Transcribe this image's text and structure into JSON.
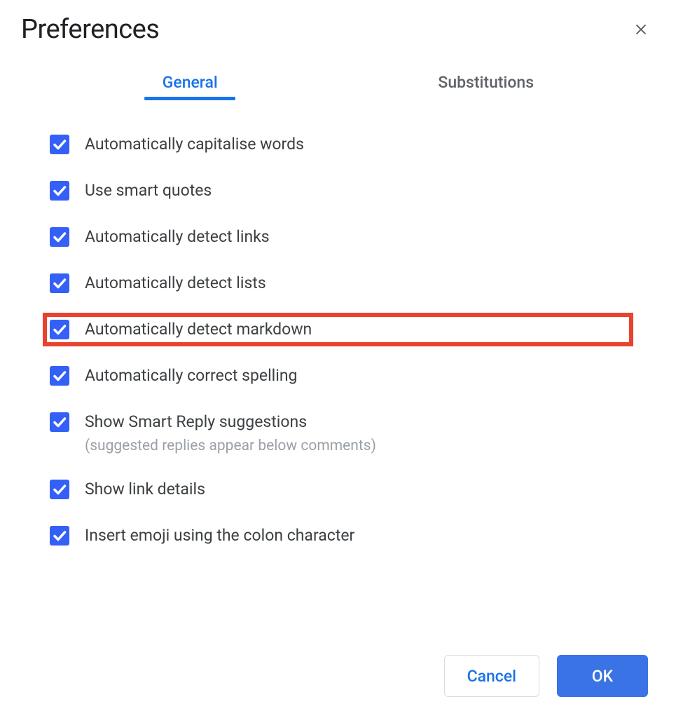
{
  "dialog": {
    "title": "Preferences"
  },
  "tabs": {
    "general": "General",
    "substitutions": "Substitutions"
  },
  "options": {
    "capitalise": {
      "label": "Automatically capitalise words",
      "checked": true,
      "highlighted": false
    },
    "smart_quotes": {
      "label": "Use smart quotes",
      "checked": true,
      "highlighted": false
    },
    "detect_links": {
      "label": "Automatically detect links",
      "checked": true,
      "highlighted": false
    },
    "detect_lists": {
      "label": "Automatically detect lists",
      "checked": true,
      "highlighted": false
    },
    "detect_markdown": {
      "label": "Automatically detect markdown",
      "checked": true,
      "highlighted": true
    },
    "correct_spelling": {
      "label": "Automatically correct spelling",
      "checked": true,
      "highlighted": false
    },
    "smart_reply": {
      "label": "Show Smart Reply suggestions",
      "sub": "(suggested replies appear below comments)",
      "checked": true,
      "highlighted": false
    },
    "link_details": {
      "label": "Show link details",
      "checked": true,
      "highlighted": false
    },
    "emoji_colon": {
      "label": "Insert emoji using the colon character",
      "checked": true,
      "highlighted": false
    }
  },
  "buttons": {
    "cancel": "Cancel",
    "ok": "OK"
  }
}
